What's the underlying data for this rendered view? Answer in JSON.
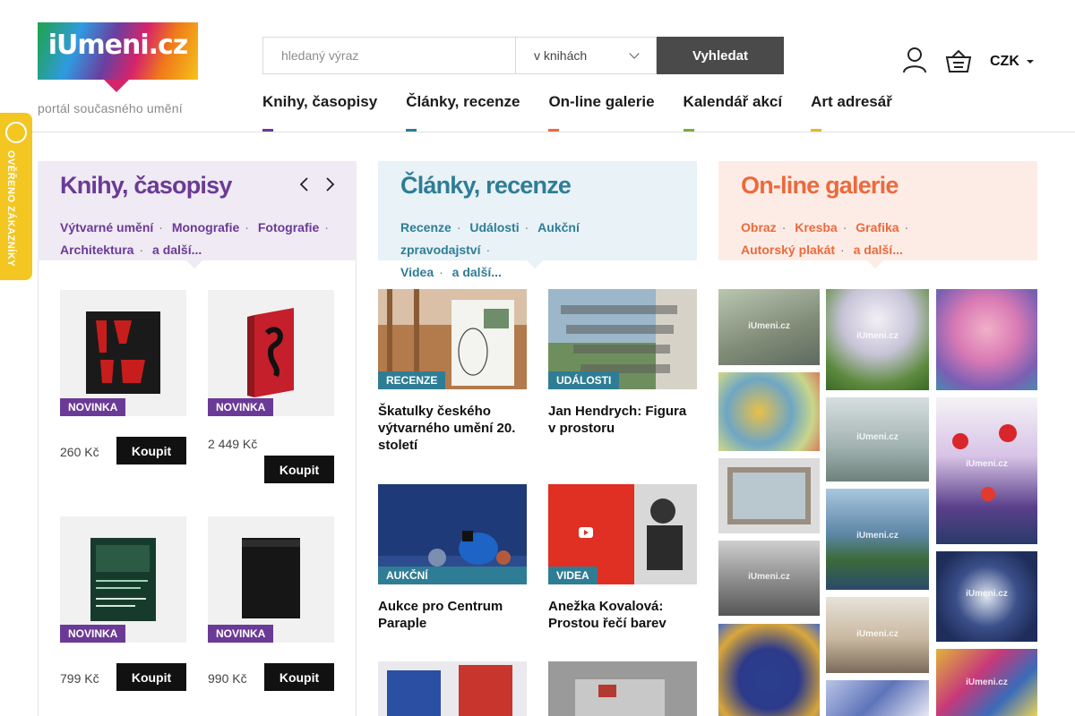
{
  "header": {
    "logo_text": "iUmeni.cz",
    "tagline": "portál současného umění",
    "search_placeholder": "hledaný výraz",
    "search_scope": "v knihách",
    "search_button": "Vyhledat",
    "currency": "CZK"
  },
  "nav": [
    {
      "label": "Knihy, časopisy",
      "color": "#6b3a96"
    },
    {
      "label": "Články, recenze",
      "color": "#2f7d95"
    },
    {
      "label": "On-line galerie",
      "color": "#ec6a3c"
    },
    {
      "label": "Kalendář akcí",
      "color": "#7bae3a"
    },
    {
      "label": "Art adresář",
      "color": "#e5b92a"
    }
  ],
  "badge": {
    "text": "OVĚŘENO ZÁKAZNÍKY"
  },
  "books": {
    "title": "Knihy, časopisy",
    "links": [
      "Výtvarné umění",
      "Monografie",
      "Fotografie",
      "Architektura",
      "a další..."
    ],
    "items": [
      {
        "tag": "NOVINKA",
        "price": "260 Kč",
        "buy": "Koupit"
      },
      {
        "tag": "NOVINKA",
        "price": "2 449 Kč",
        "buy": "Koupit"
      },
      {
        "tag": "NOVINKA",
        "price": "799 Kč",
        "buy": "Koupit"
      },
      {
        "tag": "NOVINKA",
        "price": "990 Kč",
        "buy": "Koupit"
      }
    ]
  },
  "articles": {
    "title": "Články, recenze",
    "links": [
      "Recenze",
      "Události",
      "Aukční zpravodajství",
      "Videa",
      "a další..."
    ],
    "items": [
      {
        "tag": "RECENZE",
        "title": "Škatulky českého výtvarného umění 20. století"
      },
      {
        "tag": "UDÁLOSTI",
        "title": "Jan Hendrych: Figura v prostoru"
      },
      {
        "tag": "AUKČNÍ ZPRAVODAJSTVÍ",
        "title": "Aukce pro Centrum Paraple"
      },
      {
        "tag": "VIDEA",
        "title": "Anežka Kovalová: Prostou řečí barev"
      }
    ]
  },
  "gallery": {
    "title": "On-line galerie",
    "links": [
      "Obraz",
      "Kresba",
      "Grafika",
      "Autorský plakát",
      "a další..."
    ],
    "watermark": "iUmeni.cz"
  }
}
